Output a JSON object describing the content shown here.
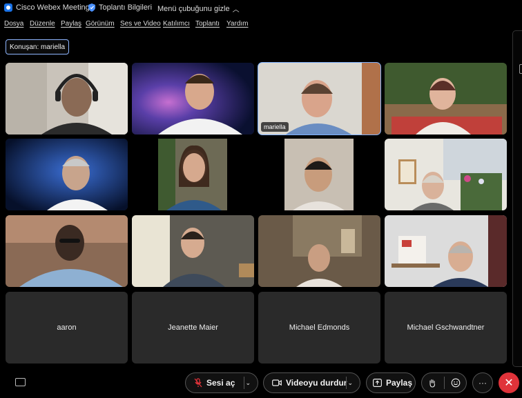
{
  "titlebar": {
    "app_name": "Cisco Webex Meetings",
    "meeting_info": "Toplantı Bilgileri",
    "hide_menu": "Menü çubuğunu gizle"
  },
  "menu": {
    "items": [
      "Dosya",
      "Düzenle",
      "Paylaş",
      "Görünüm",
      "Ses ve Video",
      "Katılımcı",
      "Toplantı",
      "Yardım"
    ]
  },
  "speaker": {
    "text": "Konuşan: mariella"
  },
  "participants": [
    {
      "name": "",
      "video": true
    },
    {
      "name": "",
      "video": true
    },
    {
      "name": "mariella",
      "video": true,
      "active": true
    },
    {
      "name": "",
      "video": true
    },
    {
      "name": "",
      "video": true
    },
    {
      "name": "",
      "video": true
    },
    {
      "name": "",
      "video": true
    },
    {
      "name": "",
      "video": true
    },
    {
      "name": "",
      "video": true
    },
    {
      "name": "",
      "video": true
    },
    {
      "name": "",
      "video": true
    },
    {
      "name": "",
      "video": true
    },
    {
      "name": "aaron",
      "video": false
    },
    {
      "name": "Jeanette Maier",
      "video": false
    },
    {
      "name": "Michael Edmonds",
      "video": false
    },
    {
      "name": "Michael Gschwandtner",
      "video": false
    }
  ],
  "toolbar": {
    "unmute_label": "Sesi aç",
    "stop_video_label": "Videoyu durdur",
    "share_label": "Paylaş",
    "more_label": "···",
    "end_label": "✕"
  },
  "colors": {
    "accent": "#7fb2ff",
    "end_call": "#e0333a",
    "mute_red": "#e0333a"
  }
}
